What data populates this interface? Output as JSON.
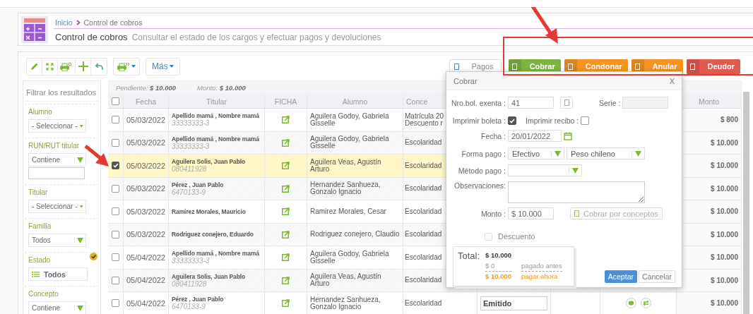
{
  "breadcrumb": {
    "home": "Inicio",
    "current": "Control de cobros"
  },
  "page": {
    "title": "Control de cobros",
    "subtitle": "Consultar el estado de los cargos y efectuar pagos y devoluciones"
  },
  "toolbar": {
    "more": "Más"
  },
  "actions": [
    {
      "label": "Pagos",
      "kind": "default"
    },
    {
      "label": "Cobrar",
      "kind": "success"
    },
    {
      "label": "Condonar",
      "kind": "warning"
    },
    {
      "label": "Anular",
      "kind": "warning"
    },
    {
      "label": "Deudor",
      "kind": "danger"
    }
  ],
  "filters": {
    "placeholder": "Filtrar los resultados",
    "groups": [
      {
        "label": "Alumno",
        "kind": "select",
        "value": "- Seleccionar -",
        "active": false
      },
      {
        "label": "RUN/RUT titular",
        "kind": "text_match",
        "value": "Contiene",
        "active": false
      },
      {
        "label": "Titular",
        "kind": "select",
        "value": "- Seleccionar -",
        "active": false
      },
      {
        "label": "Familia",
        "kind": "select",
        "value": "Todos",
        "active": false
      },
      {
        "label": "Estado",
        "kind": "list",
        "value": "Todos",
        "active": true
      },
      {
        "label": "Concepto",
        "kind": "select",
        "value": "Contiene",
        "active": false
      }
    ]
  },
  "summary": {
    "pendiente_label": "Pendiente:",
    "pendiente": "$ 10.000",
    "monto_label": "Monto:",
    "monto": "$ 10.000"
  },
  "table": {
    "all_selected": false,
    "columns": {
      "fecha": "Fecha",
      "titular": "Titular",
      "ficha": "FICHA",
      "alumno": "Alumno",
      "concepto": "Conce",
      "monto": "Monto"
    },
    "rows": [
      {
        "selected": false,
        "fecha": "05/03/2022",
        "titular": "Apellido mamá , Nombre mamá",
        "rut": "33333333-3",
        "alumno": "Aguilera Godoy, Gabriela Gisselle",
        "concepto": [
          "Matrícula 20",
          "Descuento r"
        ],
        "monto": "$ 800"
      },
      {
        "selected": false,
        "fecha": "05/03/2022",
        "titular": "Apellido mamá , Nombre mamá",
        "rut": "33333333-3",
        "alumno": "Aguilera Godoy, Gabriela Gisselle",
        "concepto": [
          "Escolaridad"
        ],
        "monto": "$ 10.000"
      },
      {
        "selected": true,
        "fecha": "05/03/2022",
        "titular": "Aguilera Solis, Juan Pablo",
        "rut": "080411928",
        "alumno": "Aguilera Veas, Agustín Arturo",
        "concepto": [
          "Escolaridad"
        ],
        "monto": "$ 10.000"
      },
      {
        "selected": false,
        "fecha": "05/03/2022",
        "titular": "Pérez , Juan Pablo",
        "rut": "6470133-9",
        "alumno": "Hernandez Sanhueza, Gonzalo Ignacio",
        "concepto": [
          "Escolaridad"
        ],
        "monto": "$ 10.000"
      },
      {
        "selected": false,
        "fecha": "05/03/2022",
        "titular": "Ramirez Morales, Mauricio",
        "alumno": "Ramirez Morales, Cesar",
        "concepto": [
          "Escolaridad"
        ],
        "monto": "$ 10.000"
      },
      {
        "selected": false,
        "fecha": "05/03/2022",
        "titular": "Rodriguez conejero, Eduardo",
        "alumno": "Rodriguez conejero, Claudio",
        "concepto": [
          "Escolaridad"
        ],
        "monto": "$ 10.000"
      },
      {
        "selected": false,
        "fecha": "05/04/2022",
        "titular": "Apellido mamá , Nombre mamá",
        "rut": "33333333-3",
        "alumno": "Aguilera Godoy, Gabriela Gisselle",
        "concepto": [
          "Escolaridad"
        ],
        "monto": "$ 10.000"
      },
      {
        "selected": false,
        "fecha": "05/04/2022",
        "titular": "Aguilera Solis, Juan Pablo",
        "rut": "080411928",
        "alumno": "Aguilera Veas, Agustín Arturo",
        "concepto": [
          "Escolaridad"
        ],
        "monto": "$ 10.000"
      },
      {
        "selected": false,
        "fecha": "05/04/2022",
        "titular": "Pérez , Juan Pablo",
        "rut": "6470133-9",
        "alumno": "Hernandez Sanhueza, Gonzalo Ignacio",
        "concepto": [
          "Escolaridad"
        ],
        "estado": "Emitido",
        "monto": "$ 10.000"
      }
    ]
  },
  "dialog": {
    "title": "Cobrar",
    "close": "X",
    "nro_label": "Nro.bol. exenta :",
    "nro": "41",
    "serie_label": "Serie :",
    "boleta_label": "Imprimir boleta :",
    "boleta": true,
    "recibo_label": "Imprimir recibo :",
    "recibo": false,
    "fecha_label": "Fecha :",
    "fecha": "20/01/2022",
    "forma_label": "Forma pago :",
    "forma": "Efectivo",
    "moneda": "Peso chileno",
    "metodo_label": "Método pago :",
    "obs_label": "Observaciones:",
    "monto_label": "Monto :",
    "monto": "$ 10.000",
    "conceptos": "Cobrar por conceptos",
    "descuento_label": "Descuento",
    "descuento": false,
    "total_label": "Total:",
    "total": "$ 10.000",
    "pagado": "$ 0",
    "pagado_label": "pagado antes",
    "ahora": "$ 10.000",
    "ahora_label": "pagar ahora",
    "accept": "Aceptar",
    "cancel": "Cancelar"
  }
}
